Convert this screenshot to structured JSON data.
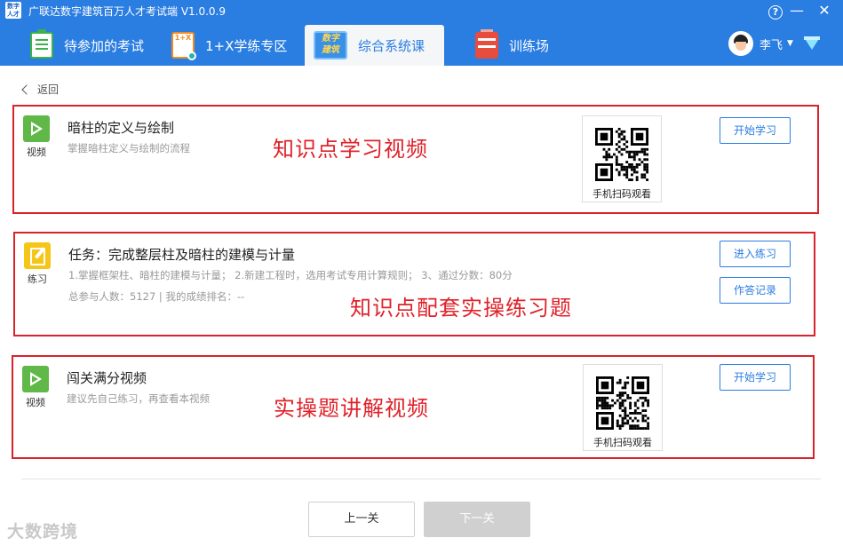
{
  "window": {
    "title": "广联达数字建筑百万人才考试端 V1.0.0.9",
    "logo_text": "数字\n人才"
  },
  "nav": {
    "tabs": [
      {
        "label": "待参加的考试",
        "icon": "exam-clipboard-icon"
      },
      {
        "label": "1+X学练专区",
        "icon": "one-plus-x-icon"
      },
      {
        "label": "综合系统课",
        "icon": "digital-building-icon",
        "active": true
      },
      {
        "label": "训练场",
        "icon": "training-icon"
      }
    ],
    "course_icon_text": "数字\n建筑",
    "onex_icon_text": "1+X"
  },
  "user": {
    "name": "李飞"
  },
  "back_label": "返回",
  "items": [
    {
      "type_label": "视频",
      "title": "暗柱的定义与绘制",
      "subtitle": "掌握暗柱定义与绘制的流程",
      "qr_label": "手机扫码观看",
      "button": "开始学习",
      "annotation": "知识点学习视频"
    },
    {
      "type_label": "练习",
      "title": "任务：完成整层柱及暗柱的建模与计量",
      "subtitle": "1.掌握框架柱、暗柱的建模与计量； 2.新建工程时，选用考试专用计算规则； 3、通过分数：80分",
      "stats": "总参与人数：5127 | 我的成绩排名：--",
      "button_primary": "进入练习",
      "button_secondary": "作答记录",
      "annotation": "知识点配套实操练习题"
    },
    {
      "type_label": "视频",
      "title": "闯关满分视频",
      "subtitle": "建议先自己练习，再查看本视频",
      "qr_label": "手机扫码观看",
      "button": "开始学习",
      "annotation": "实操题讲解视频"
    }
  ],
  "pager": {
    "prev": "上一关",
    "next": "下一关"
  },
  "watermark": "大数跨境",
  "colors": {
    "brand_blue": "#2a7de1",
    "annotation_red": "#e0222a",
    "video_green": "#5fb847",
    "practice_yellow": "#f5c518"
  }
}
